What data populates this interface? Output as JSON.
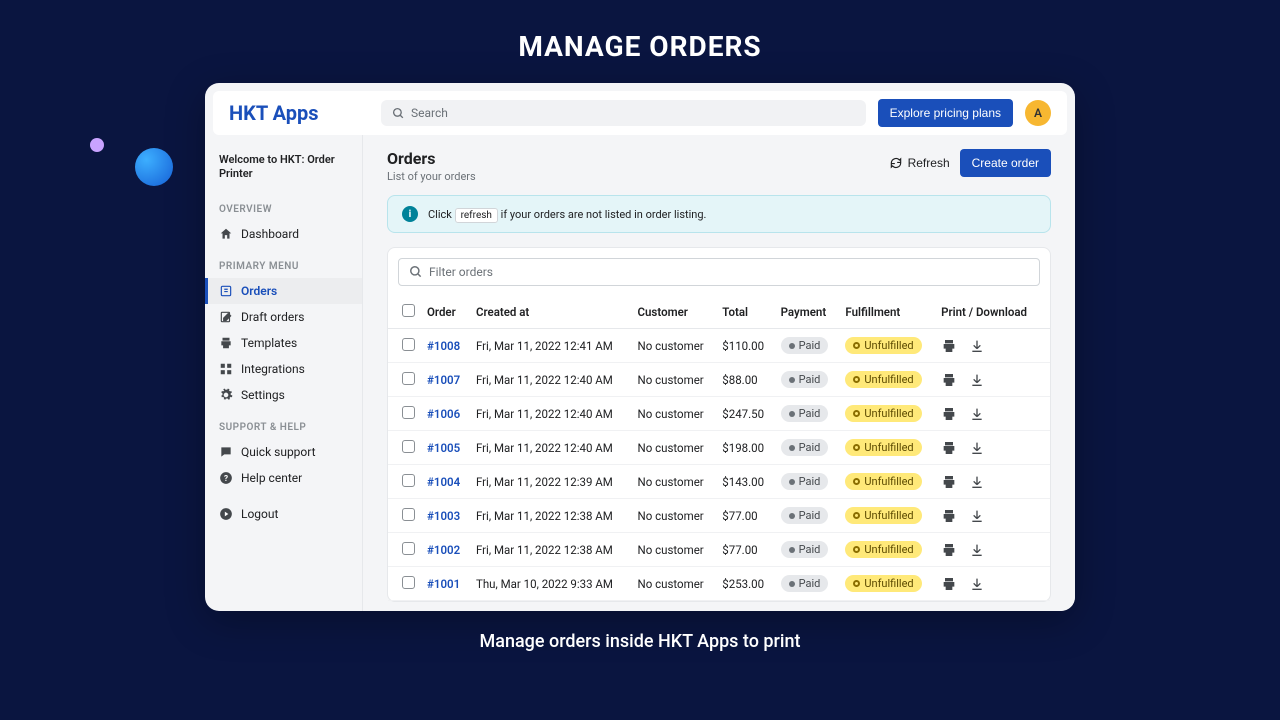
{
  "hero": {
    "title": "MANAGE ORDERS",
    "subtitle": "Manage orders inside HKT Apps to print"
  },
  "topbar": {
    "brand": "HKT Apps",
    "search_placeholder": "Search",
    "explore_btn": "Explore pricing plans",
    "avatar_initial": "A"
  },
  "sidebar": {
    "welcome": "Welcome to HKT: Order Printer",
    "sections": {
      "overview_label": "OVERVIEW",
      "overview_items": {
        "dashboard": "Dashboard"
      },
      "primary_label": "PRIMARY MENU",
      "primary_items": {
        "orders": "Orders",
        "draft_orders": "Draft orders",
        "templates": "Templates",
        "integrations": "Integrations",
        "settings": "Settings"
      },
      "support_label": "SUPPORT & HELP",
      "support_items": {
        "quick_support": "Quick support",
        "help_center": "Help center"
      },
      "logout": "Logout"
    }
  },
  "page": {
    "title": "Orders",
    "subtitle": "List of your orders",
    "refresh_btn": "Refresh",
    "create_btn": "Create order"
  },
  "banner": {
    "prefix": "Click",
    "code": "refresh",
    "suffix": "if your orders are not listed in order listing."
  },
  "filter": {
    "placeholder": "Filter orders"
  },
  "table": {
    "headers": {
      "order": "Order",
      "created": "Created at",
      "customer": "Customer",
      "total": "Total",
      "payment": "Payment",
      "fulfillment": "Fulfillment",
      "print": "Print / Download"
    },
    "rows": [
      {
        "order": "#1008",
        "created": "Fri, Mar 11, 2022 12:41 AM",
        "customer": "No customer",
        "total": "$110.00",
        "payment": "Paid",
        "fulfillment": "Unfulfilled"
      },
      {
        "order": "#1007",
        "created": "Fri, Mar 11, 2022 12:40 AM",
        "customer": "No customer",
        "total": "$88.00",
        "payment": "Paid",
        "fulfillment": "Unfulfilled"
      },
      {
        "order": "#1006",
        "created": "Fri, Mar 11, 2022 12:40 AM",
        "customer": "No customer",
        "total": "$247.50",
        "payment": "Paid",
        "fulfillment": "Unfulfilled"
      },
      {
        "order": "#1005",
        "created": "Fri, Mar 11, 2022 12:40 AM",
        "customer": "No customer",
        "total": "$198.00",
        "payment": "Paid",
        "fulfillment": "Unfulfilled"
      },
      {
        "order": "#1004",
        "created": "Fri, Mar 11, 2022 12:39 AM",
        "customer": "No customer",
        "total": "$143.00",
        "payment": "Paid",
        "fulfillment": "Unfulfilled"
      },
      {
        "order": "#1003",
        "created": "Fri, Mar 11, 2022 12:38 AM",
        "customer": "No customer",
        "total": "$77.00",
        "payment": "Paid",
        "fulfillment": "Unfulfilled"
      },
      {
        "order": "#1002",
        "created": "Fri, Mar 11, 2022 12:38 AM",
        "customer": "No customer",
        "total": "$77.00",
        "payment": "Paid",
        "fulfillment": "Unfulfilled"
      },
      {
        "order": "#1001",
        "created": "Thu, Mar 10, 2022 9:33 AM",
        "customer": "No customer",
        "total": "$253.00",
        "payment": "Paid",
        "fulfillment": "Unfulfilled"
      }
    ]
  }
}
